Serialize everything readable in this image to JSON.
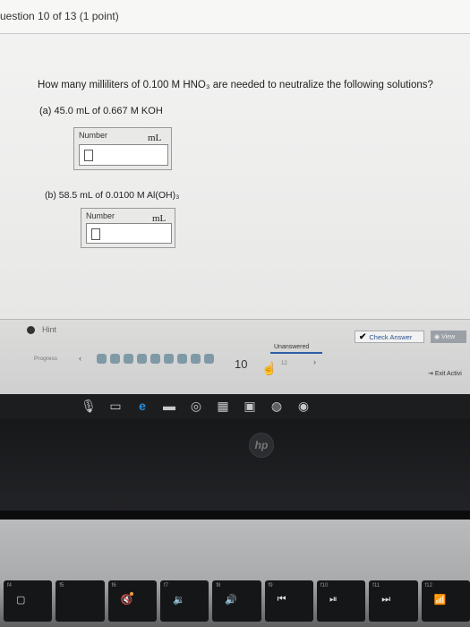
{
  "header": {
    "title": "uestion 10 of 13 (1 point)"
  },
  "question": {
    "text": "How many milliliters of 0.100 M HNO₃ are needed to neutralize the following solutions?"
  },
  "part_a": {
    "label": "(a) 45.0 mL of 0.667 M KOH",
    "box_label": "Number",
    "value": "",
    "unit": "mL"
  },
  "part_b": {
    "label": "(b) 58.5 mL of 0.0100 M Al(OH)₃",
    "box_label": "Number",
    "value": "",
    "unit": "mL"
  },
  "toolbar": {
    "hint_label": "Hint",
    "check_label": "Check Answer",
    "view_label": "View",
    "status": "Unanswered"
  },
  "progress": {
    "label": "Progress",
    "current": "10",
    "next": "12",
    "exit_label": "Exit Activi"
  },
  "laptop": {
    "logo": "hp"
  },
  "keys": [
    {
      "fn": "f4",
      "icon": "window-icon"
    },
    {
      "fn": "f5",
      "icon": "blank"
    },
    {
      "fn": "f6",
      "icon": "volume-mute-icon"
    },
    {
      "fn": "f7",
      "icon": "volume-down-icon"
    },
    {
      "fn": "f8",
      "icon": "volume-up-icon"
    },
    {
      "fn": "f9",
      "icon": "previous-track-icon"
    },
    {
      "fn": "f10",
      "icon": "play-pause-icon"
    },
    {
      "fn": "f11",
      "icon": "next-track-icon"
    },
    {
      "fn": "f12",
      "icon": "wireless-icon"
    }
  ]
}
